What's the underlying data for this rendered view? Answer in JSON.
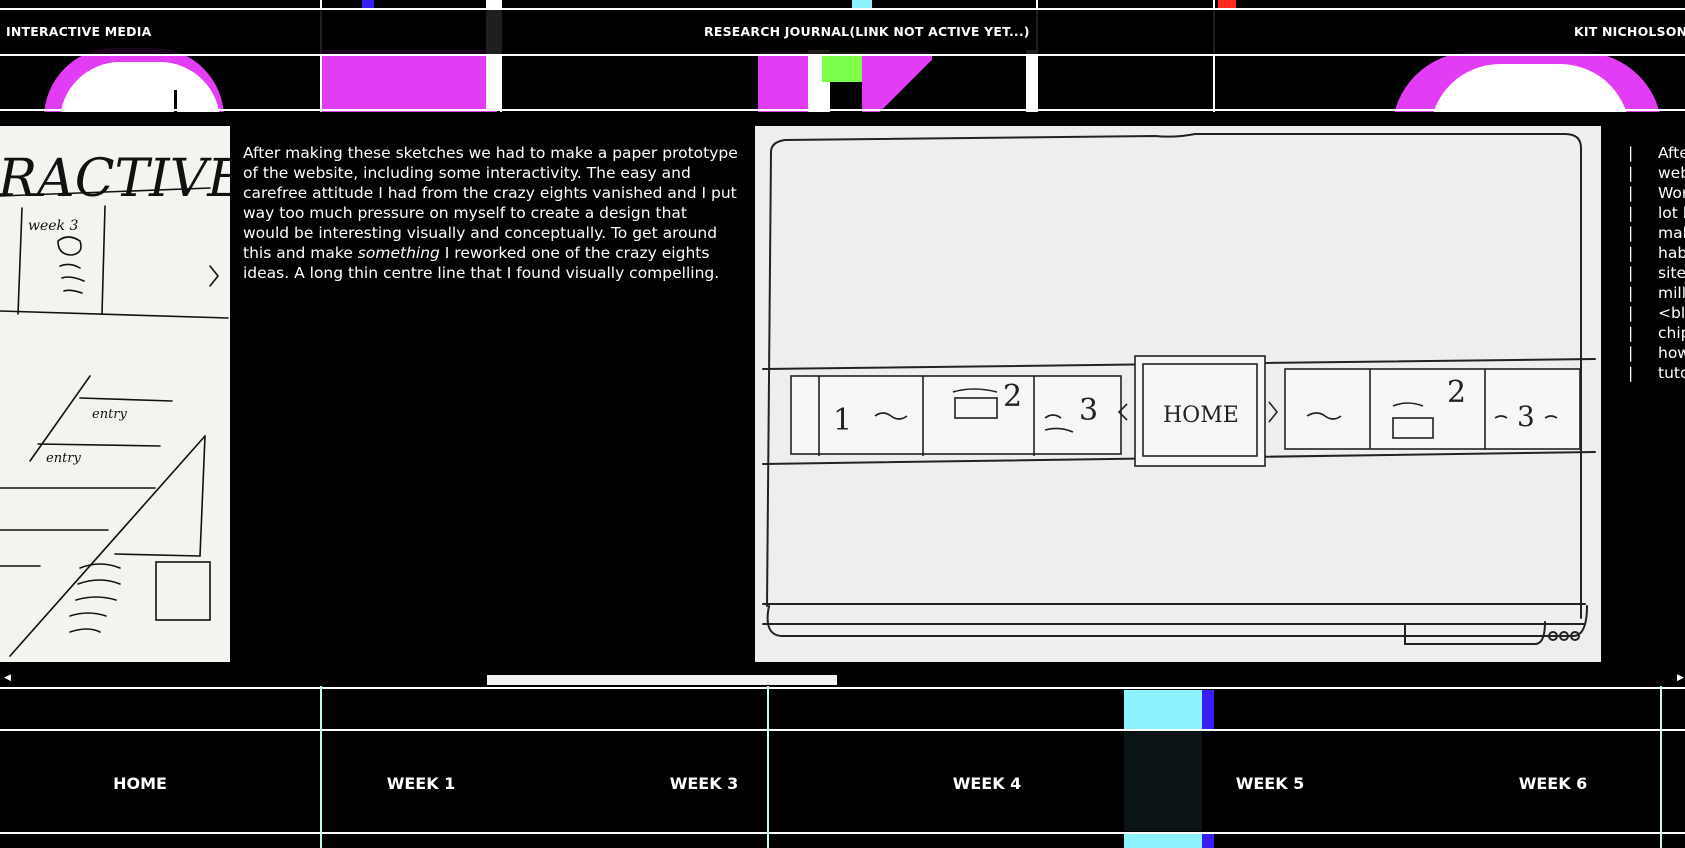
{
  "header": {
    "left_title": "INTERACTIVE MEDIA",
    "center_link": "RESEARCH JOURNAL(LINK NOT ACTIVE YET...)",
    "right_name": "KIT NICHOLSON"
  },
  "main": {
    "paragraph_part1": "After making these sketches we had to make a paper prototype of the website, including some interactivity. The easy and carefree attitude I had from the crazy eights vanished and I put way too much pressure on myself to create a design that would be interesting visually and conceptually. To get around this and make ",
    "paragraph_emphasis": "something",
    "paragraph_part2": " I reworked one of the crazy eights ideas. A long thin centre line that I found visually compelling.",
    "left_sketch": {
      "title": "RACTIVE",
      "week_label": "week 3",
      "entry1": "entry",
      "entry2": "entry"
    },
    "right_sketch": {
      "home_label": "HOME",
      "panel_1": "1",
      "panel_2": "2",
      "panel_3": "3",
      "panel_4": "2",
      "panel_5": "3"
    },
    "next_column": {
      "bars": [
        "|",
        "|",
        "|",
        "|",
        "|",
        "|",
        "|",
        "|",
        "|",
        "|",
        "|",
        "|"
      ],
      "fragments": [
        "Afte",
        "web",
        "Wor",
        "lot l",
        "mak",
        "hab",
        "site",
        "mill",
        "<bla",
        "chip",
        "how",
        "tuto"
      ]
    }
  },
  "bottom_nav": {
    "items": [
      "HOME",
      "WEEK 1",
      "WEEK 3",
      "WEEK 4",
      "WEEK 5",
      "WEEK 6"
    ]
  },
  "colors": {
    "magenta": "#e23cf4",
    "cyan": "#8ef3ff",
    "blue": "#3a1ff0",
    "green": "#7aff4a",
    "red": "#ff2a1a"
  }
}
